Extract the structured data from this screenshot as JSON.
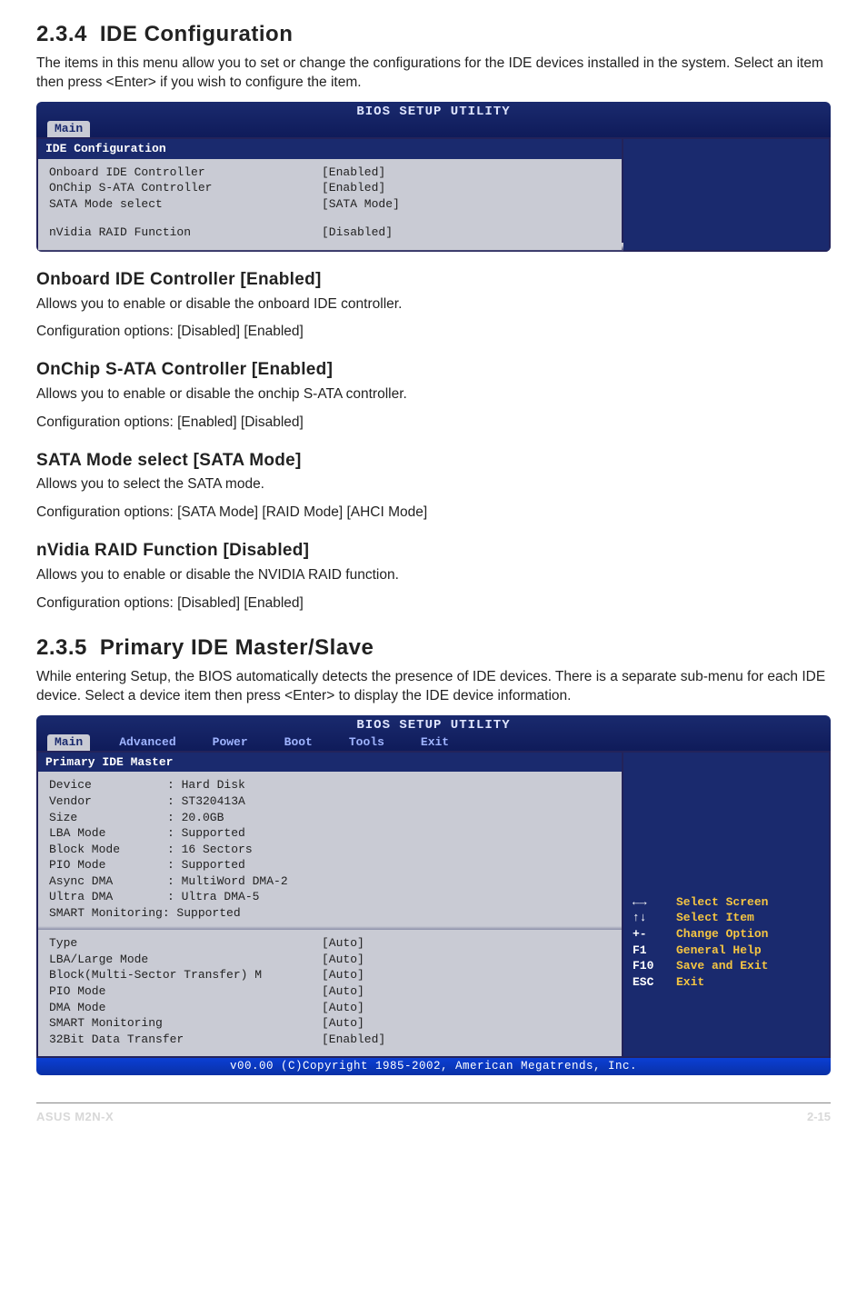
{
  "sec234": {
    "num": "2.3.4",
    "title": "IDE Configuration"
  },
  "intro234": "The items in this menu allow you to set or change the configurations for the IDE devices installed in the system. Select an item then press <Enter> if you wish to configure the item.",
  "bios1": {
    "title": "BIOS SETUP UTILITY",
    "tab_main": "Main",
    "subhead": "IDE Configuration",
    "r1k": "Onboard IDE Controller",
    "r1v": "[Enabled]",
    "r2k": "OnChip S-ATA Controller",
    "r2v": "[Enabled]",
    "r3k": "SATA Mode select",
    "r3v": "[SATA Mode]",
    "r4k": "nVidia RAID Function",
    "r4v": "[Disabled]"
  },
  "sub_onboard": {
    "h": "Onboard IDE Controller [Enabled]",
    "p1": "Allows you to enable or disable the onboard IDE controller.",
    "p2": "Configuration options: [Disabled] [Enabled]"
  },
  "sub_onchip": {
    "h": "OnChip S-ATA Controller [Enabled]",
    "p1": "Allows you to enable or disable the onchip S-ATA controller.",
    "p2": "Configuration options: [Enabled] [Disabled]"
  },
  "sub_sata": {
    "h": "SATA Mode select [SATA Mode]",
    "p1": "Allows you to select the SATA mode.",
    "p2": "Configuration options: [SATA Mode] [RAID Mode] [AHCI Mode]"
  },
  "sub_nvidia": {
    "h": "nVidia RAID Function [Disabled]",
    "p1": "Allows you to enable or disable the NVIDIA RAID function.",
    "p2": "Configuration options: [Disabled] [Enabled]"
  },
  "sec235": {
    "num": "2.3.5",
    "title": "Primary IDE Master/Slave"
  },
  "intro235": "While entering Setup, the BIOS automatically detects the presence of IDE devices. There is a separate sub-menu for each IDE device. Select a device item then press <Enter> to display the IDE device information.",
  "bios2": {
    "title": "BIOS SETUP UTILITY",
    "tabs": {
      "main": "Main",
      "adv": "Advanced",
      "power": "Power",
      "boot": "Boot",
      "tools": "Tools",
      "exit": "Exit"
    },
    "subhead": "Primary IDE Master",
    "info": {
      "k1": "Device",
      "v1": ": Hard Disk",
      "k2": "Vendor",
      "v2": ": ST320413A",
      "k3": "Size",
      "v3": ": 20.0GB",
      "k4": "LBA Mode",
      "v4": ": Supported",
      "k5": "Block Mode",
      "v5": ": 16 Sectors",
      "k6": "PIO Mode",
      "v6": ": Supported",
      "k7": "Async DMA",
      "v7": ": MultiWord DMA-2",
      "k8": "Ultra DMA",
      "v8": ": Ultra DMA-5",
      "k9": "SMART Monitoring: Supported"
    },
    "opts": {
      "k1": "Type",
      "v1": "[Auto]",
      "k2": "LBA/Large Mode",
      "v2": "[Auto]",
      "k3": "Block(Multi-Sector Transfer) M",
      "v3": "[Auto]",
      "k4": "PIO Mode",
      "v4": "[Auto]",
      "k5": "DMA Mode",
      "v5": "[Auto]",
      "k6": "SMART Monitoring",
      "v6": "[Auto]",
      "k7": "32Bit Data Transfer",
      "v7": "[Enabled]"
    },
    "legend": {
      "l1k": "←→",
      "l1v": "Select Screen",
      "l2k": "↑↓",
      "l2v": "Select Item",
      "l3k": "+-",
      "l3v": "Change Option",
      "l4k": "F1",
      "l4v": "General Help",
      "l5k": "F10",
      "l5v": "Save and Exit",
      "l6k": "ESC",
      "l6v": "Exit"
    },
    "copyright": "v00.00 (C)Copyright 1985-2002, American Megatrends, Inc."
  },
  "footer": {
    "left": "ASUS M2N-X",
    "right": "2-15"
  }
}
